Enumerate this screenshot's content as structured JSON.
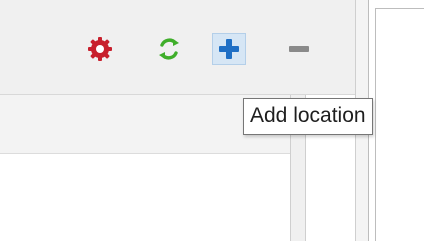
{
  "toolbar": {
    "buttons": [
      {
        "name": "settings",
        "icon": "gear-icon",
        "color": "#c8202d"
      },
      {
        "name": "refresh",
        "icon": "refresh-icon",
        "color": "#3fae2a"
      },
      {
        "name": "add",
        "icon": "plus-icon",
        "color": "#1f6fc5"
      },
      {
        "name": "remove",
        "icon": "minus-icon",
        "color": "#8a8a8a"
      }
    ]
  },
  "tooltip": {
    "text": "Add location"
  }
}
